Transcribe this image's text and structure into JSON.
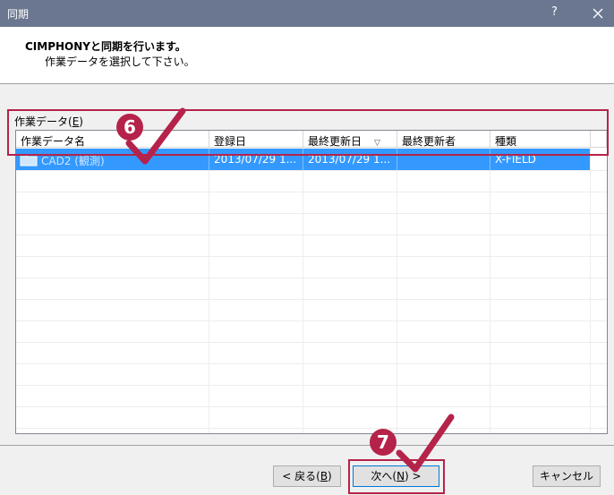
{
  "window": {
    "title": "同期",
    "help_glyph": "?",
    "close_glyph": "×"
  },
  "header": {
    "line1": "CIMPHONYと同期を行います。",
    "line2": "作業データを選択して下さい。"
  },
  "group": {
    "label_prefix": "作業データ(",
    "mnemonic": "E",
    "label_suffix": ")"
  },
  "table": {
    "columns": [
      "作業データ名",
      "登録日",
      "最終更新日",
      "最終更新者",
      "種類"
    ],
    "sort_indicator": "▽",
    "rows": [
      {
        "name": "CAD2 (観測)",
        "registered": "2013/07/29 1...",
        "updated": "2013/07/29 1...",
        "updater": "",
        "type": "X-FIELD"
      }
    ]
  },
  "buttons": {
    "back": {
      "prefix": "< 戻る(",
      "mnemonic": "B",
      "suffix": ")"
    },
    "next": {
      "prefix": "次へ(",
      "mnemonic": "N",
      "suffix": ") >"
    },
    "cancel": "キャンセル"
  },
  "annotations": {
    "step6": "6",
    "step7": "7",
    "accent_color": "#b5234a",
    "selection_color": "#3399ff"
  }
}
